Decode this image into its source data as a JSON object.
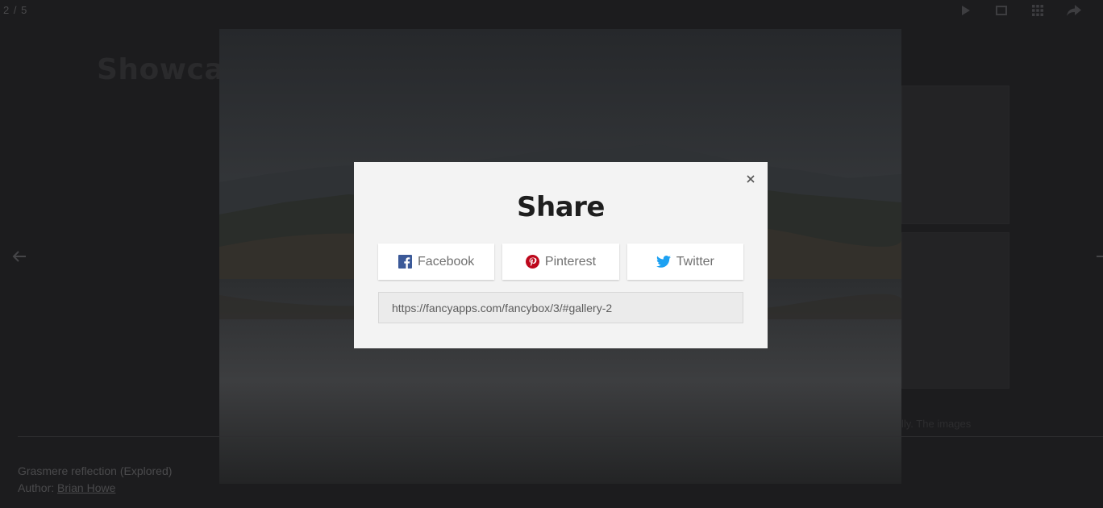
{
  "viewer": {
    "counter": "2 / 5",
    "toolbar": {
      "slideshow_icon": "play-icon",
      "fullscreen_icon": "fullscreen-icon",
      "thumbs_icon": "grid-icon",
      "share_icon": "share-icon"
    },
    "nav": {
      "prev_icon": "arrow-left-icon",
      "next_icon": "arrow-right-icon"
    },
    "caption": {
      "title": "Grasmere reflection (Explored)",
      "author_prefix": "Author: ",
      "author_name": "Brian Howe"
    }
  },
  "background_page": {
    "title": "Showcas",
    "hint": "lly. The images"
  },
  "share_modal": {
    "title": "Share",
    "buttons": [
      {
        "label": "Facebook",
        "icon": "facebook-icon",
        "color": "#3b5998"
      },
      {
        "label": "Pinterest",
        "icon": "pinterest-icon",
        "color": "#bd081c"
      },
      {
        "label": "Twitter",
        "icon": "twitter-icon",
        "color": "#1da1f2"
      }
    ],
    "url_value": "https://fancyapps.com/fancybox/3/#gallery-2",
    "close_icon": "close-icon"
  }
}
